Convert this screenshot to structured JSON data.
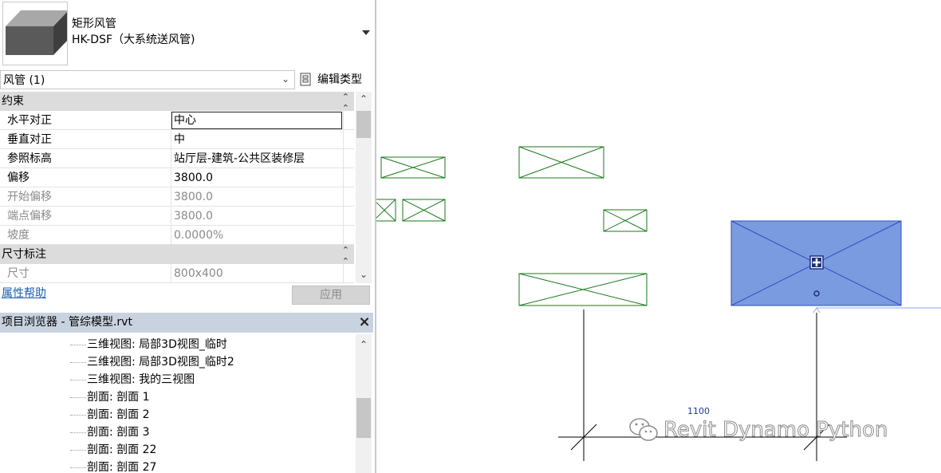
{
  "type_selector": {
    "type_name": "矩形风管",
    "family_type": "HK-DSF（大系统送风管)"
  },
  "filter": {
    "selection_label": "风管 (1)",
    "edit_type_label": "编辑类型"
  },
  "properties": {
    "group_constraints": "约束",
    "group_dimensions": "尺寸标注",
    "rows": [
      {
        "key": "水平对正",
        "value": "中心"
      },
      {
        "key": "垂直对正",
        "value": "中"
      },
      {
        "key": "参照标高",
        "value": "站厅层-建筑-公共区装修层"
      },
      {
        "key": "偏移",
        "value": "3800.0"
      },
      {
        "key": "开始偏移",
        "value": "3800.0"
      },
      {
        "key": "端点偏移",
        "value": "3800.0"
      },
      {
        "key": "坡度",
        "value": "0.0000%"
      },
      {
        "key": "尺寸",
        "value": "800x400"
      }
    ],
    "help_link": "属性帮助",
    "apply_button": "应用"
  },
  "project_browser": {
    "title": "项目浏览器 - 管综模型.rvt",
    "items": [
      "三维视图: 局部3D视图_临时",
      "三维视图: 局部3D视图_临时2",
      "三维视图: 我的三视图",
      "剖面: 剖面 1",
      "剖面: 剖面 2",
      "剖面: 剖面 3",
      "剖面: 剖面 22",
      "剖面: 剖面 27"
    ]
  },
  "canvas": {
    "dimension_value": "1100",
    "watermark": "Revit Dynamo Python",
    "selection_color": "#7b9be0",
    "duct_color": "#1a7a1a"
  }
}
